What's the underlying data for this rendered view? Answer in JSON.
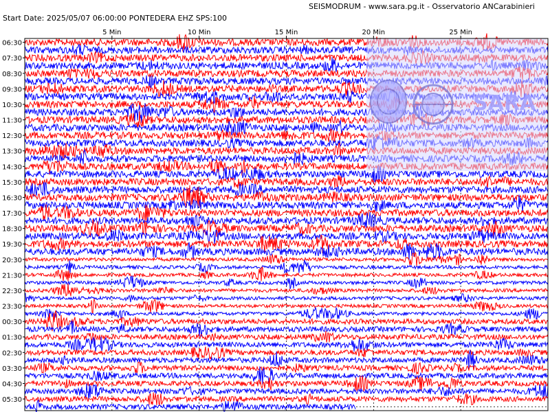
{
  "header": {
    "title": "SEISMODRUM - www.sara.pg.it - Osservatorio ANCarabinieri",
    "start_info": "Start Date: 2025/05/07 06:00:00 PONTEDERA  EHZ  SPS:100"
  },
  "watermark": {
    "text": "SARA",
    "seal_text": "Oss. ANCarabinieri"
  },
  "colors": {
    "trace_a": "#ff0000",
    "trace_b": "#0000ff",
    "axis": "#000000",
    "grid": "#000000",
    "watermark": "#a0a0ff"
  },
  "chart_data": {
    "type": "line",
    "title": "",
    "xlabel": "",
    "ylabel": "",
    "x_unit": "minutes",
    "xlim": [
      0,
      30
    ],
    "x_ticks": [
      5,
      10,
      15,
      20,
      25
    ],
    "x_tick_labels": [
      "5 Min",
      "10 Min",
      "15 Min",
      "20 Min",
      "25 Min"
    ],
    "row_interval_minutes": 30,
    "rows": 48,
    "y_labels": [
      "06:30",
      "07:30",
      "08:30",
      "09:30",
      "10:30",
      "11:30",
      "12:30",
      "13:30",
      "14:30",
      "15:30",
      "16:30",
      "17:30",
      "18:30",
      "19:30",
      "20:30",
      "21:30",
      "22:30",
      "23:30",
      "00:30",
      "01:30",
      "02:30",
      "03:30",
      "04:30",
      "05:30"
    ],
    "row_colors_cycle": [
      "#ff0000",
      "#0000ff"
    ],
    "grid": "vertical-dashed",
    "last_row_end_minute": 19
  }
}
